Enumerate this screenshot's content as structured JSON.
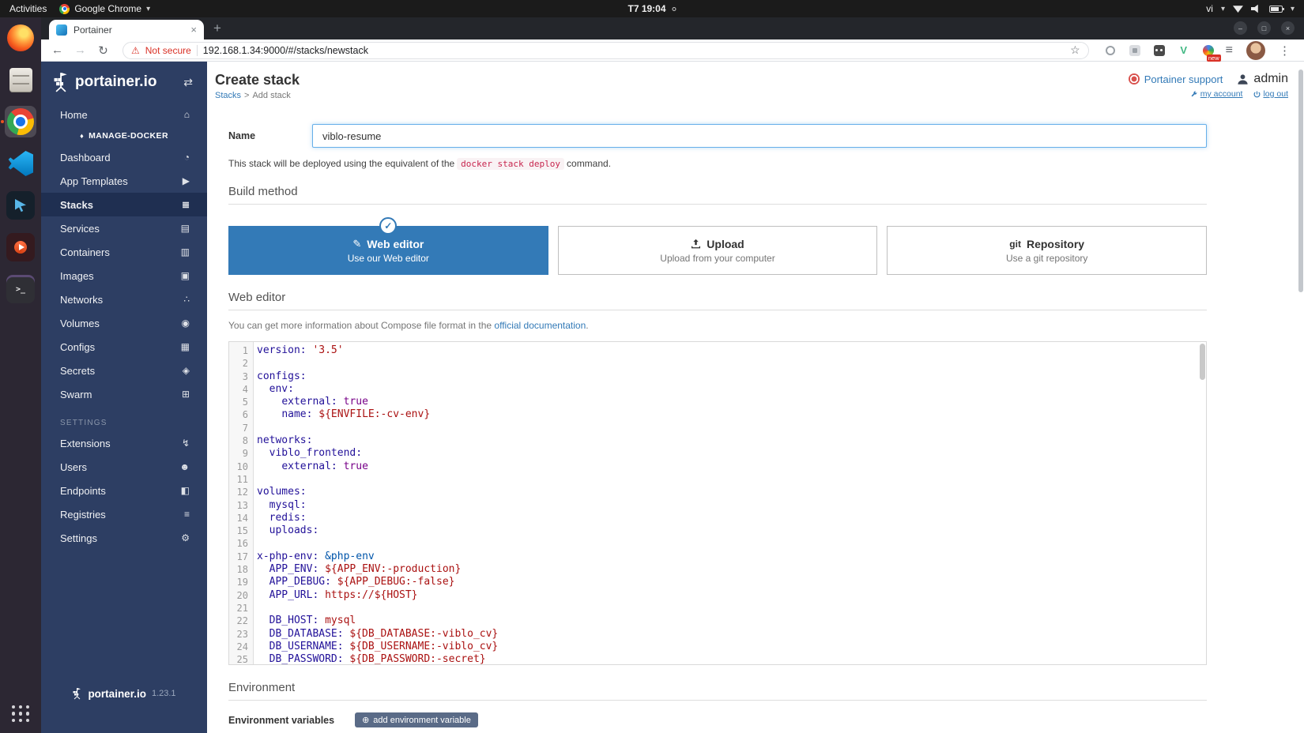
{
  "icons": {
    "caret": "▾",
    "toggle": "⇄",
    "back": "←",
    "forward": "→",
    "reload": "↻",
    "star": "☆",
    "warning": "⚠",
    "tab_close": "×",
    "new_tab": "+",
    "kebab": "⋮",
    "reading_list": "≡",
    "check": "✓",
    "pencil": "✎",
    "plus_circled": "⊕",
    "git": "git",
    "window_min": "–",
    "window_max": "□",
    "window_close": "×",
    "breadcrumb_sep": ">",
    "terminal_glyph": ">_",
    "v_ext": "V"
  },
  "desktop": {
    "activities": "Activities",
    "app_name": "Google Chrome",
    "clock": "T7 19:04",
    "keyboard_layout": "vi"
  },
  "browser": {
    "tab_title": "Portainer",
    "security_label": "Not secure",
    "url": "192.168.1.34:9000/#/stacks/newstack",
    "ext_badge": "new"
  },
  "sidebar": {
    "brand": "portainer.io",
    "items": [
      {
        "type": "item",
        "id": "home",
        "label": "Home",
        "glyph": "⌂"
      },
      {
        "type": "endpoint",
        "label": "MANAGE-DOCKER",
        "glyph": "♦"
      },
      {
        "type": "item",
        "id": "dashboard",
        "label": "Dashboard",
        "glyph": "◔"
      },
      {
        "type": "item",
        "id": "app-templates",
        "label": "App Templates",
        "glyph": "▶"
      },
      {
        "type": "item",
        "id": "stacks",
        "label": "Stacks",
        "glyph": "≣",
        "active": true
      },
      {
        "type": "item",
        "id": "services",
        "label": "Services",
        "glyph": "▤"
      },
      {
        "type": "item",
        "id": "containers",
        "label": "Containers",
        "glyph": "▥"
      },
      {
        "type": "item",
        "id": "images",
        "label": "Images",
        "glyph": "▣"
      },
      {
        "type": "item",
        "id": "networks",
        "label": "Networks",
        "glyph": "∴"
      },
      {
        "type": "item",
        "id": "volumes",
        "label": "Volumes",
        "glyph": "◉"
      },
      {
        "type": "item",
        "id": "configs",
        "label": "Configs",
        "glyph": "▦"
      },
      {
        "type": "item",
        "id": "secrets",
        "label": "Secrets",
        "glyph": "◈"
      },
      {
        "type": "item",
        "id": "swarm",
        "label": "Swarm",
        "glyph": "⊞"
      },
      {
        "type": "header",
        "label": "SETTINGS"
      },
      {
        "type": "item",
        "id": "extensions",
        "label": "Extensions",
        "glyph": "↯"
      },
      {
        "type": "item",
        "id": "users",
        "label": "Users",
        "glyph": "☻"
      },
      {
        "type": "item",
        "id": "endpoints",
        "label": "Endpoints",
        "glyph": "◧"
      },
      {
        "type": "item",
        "id": "registries",
        "label": "Registries",
        "glyph": "≡"
      },
      {
        "type": "item",
        "id": "settings",
        "label": "Settings",
        "glyph": "⚙"
      }
    ],
    "footer_brand": "portainer.io",
    "version": "1.23.1"
  },
  "header": {
    "title": "Create stack",
    "breadcrumb_link": "Stacks",
    "breadcrumb_current": "Add stack",
    "support": "Portainer support",
    "user": "admin",
    "my_account": "my account",
    "log_out": "log out"
  },
  "form": {
    "name_label": "Name",
    "name_value": "viblo-resume",
    "note_prefix": "This stack will be deployed using the equivalent of the",
    "note_code": "docker stack deploy",
    "note_suffix": "command.",
    "build_method_title": "Build method",
    "methods": [
      {
        "title": "Web editor",
        "subtitle": "Use our Web editor"
      },
      {
        "title": "Upload",
        "subtitle": "Upload from your computer"
      },
      {
        "title": "Repository",
        "subtitle": "Use a git repository"
      }
    ],
    "web_editor_title": "Web editor",
    "info_prefix": "You can get more information about Compose file format in the",
    "info_link": "official documentation",
    "info_suffix": ".",
    "environment_title": "Environment",
    "env_vars_label": "Environment variables",
    "add_env_button": "add environment variable"
  },
  "editor": {
    "lines": [
      {
        "n": "1",
        "toks": [
          [
            "key",
            "version:"
          ],
          [
            "str",
            " '3.5'"
          ]
        ]
      },
      {
        "n": "2",
        "toks": []
      },
      {
        "n": "3",
        "toks": [
          [
            "key",
            "configs:"
          ]
        ]
      },
      {
        "n": "4",
        "toks": [
          [
            "plain",
            "  "
          ],
          [
            "key",
            "env:"
          ]
        ]
      },
      {
        "n": "5",
        "toks": [
          [
            "plain",
            "    "
          ],
          [
            "key",
            "external:"
          ],
          [
            "kw",
            " true"
          ]
        ]
      },
      {
        "n": "6",
        "toks": [
          [
            "plain",
            "    "
          ],
          [
            "key",
            "name:"
          ],
          [
            "str",
            " ${ENVFILE:-cv-env}"
          ]
        ]
      },
      {
        "n": "7",
        "toks": []
      },
      {
        "n": "8",
        "toks": [
          [
            "key",
            "networks:"
          ]
        ]
      },
      {
        "n": "9",
        "toks": [
          [
            "plain",
            "  "
          ],
          [
            "key",
            "viblo_frontend:"
          ]
        ]
      },
      {
        "n": "10",
        "toks": [
          [
            "plain",
            "    "
          ],
          [
            "key",
            "external:"
          ],
          [
            "kw",
            " true"
          ]
        ]
      },
      {
        "n": "11",
        "toks": []
      },
      {
        "n": "12",
        "toks": [
          [
            "key",
            "volumes:"
          ]
        ]
      },
      {
        "n": "13",
        "toks": [
          [
            "plain",
            "  "
          ],
          [
            "key",
            "mysql:"
          ]
        ]
      },
      {
        "n": "14",
        "toks": [
          [
            "plain",
            "  "
          ],
          [
            "key",
            "redis:"
          ]
        ]
      },
      {
        "n": "15",
        "toks": [
          [
            "plain",
            "  "
          ],
          [
            "key",
            "uploads:"
          ]
        ]
      },
      {
        "n": "16",
        "toks": []
      },
      {
        "n": "17",
        "toks": [
          [
            "key",
            "x-php-env:"
          ],
          [
            "anchor",
            " &php-env"
          ]
        ]
      },
      {
        "n": "18",
        "toks": [
          [
            "plain",
            "  "
          ],
          [
            "key",
            "APP_ENV:"
          ],
          [
            "str",
            " ${APP_ENV:-production}"
          ]
        ]
      },
      {
        "n": "19",
        "toks": [
          [
            "plain",
            "  "
          ],
          [
            "key",
            "APP_DEBUG:"
          ],
          [
            "str",
            " ${APP_DEBUG:-false}"
          ]
        ]
      },
      {
        "n": "20",
        "toks": [
          [
            "plain",
            "  "
          ],
          [
            "key",
            "APP_URL:"
          ],
          [
            "str",
            " https://${HOST}"
          ]
        ]
      },
      {
        "n": "21",
        "toks": []
      },
      {
        "n": "22",
        "toks": [
          [
            "plain",
            "  "
          ],
          [
            "key",
            "DB_HOST:"
          ],
          [
            "str",
            " mysql"
          ]
        ]
      },
      {
        "n": "23",
        "toks": [
          [
            "plain",
            "  "
          ],
          [
            "key",
            "DB_DATABASE:"
          ],
          [
            "str",
            " ${DB_DATABASE:-viblo_cv}"
          ]
        ]
      },
      {
        "n": "24",
        "toks": [
          [
            "plain",
            "  "
          ],
          [
            "key",
            "DB_USERNAME:"
          ],
          [
            "str",
            " ${DB_USERNAME:-viblo_cv}"
          ]
        ]
      },
      {
        "n": "25",
        "toks": [
          [
            "plain",
            "  "
          ],
          [
            "key",
            "DB_PASSWORD:"
          ],
          [
            "str",
            " ${DB_PASSWORD:-secret}"
          ]
        ]
      }
    ]
  }
}
